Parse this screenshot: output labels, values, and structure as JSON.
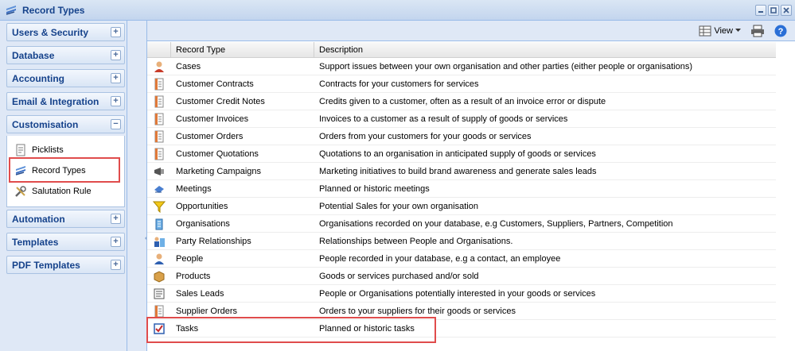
{
  "window": {
    "title": "Record Types"
  },
  "sidebar": {
    "sections": [
      {
        "label": "Users & Security",
        "toggle": "+"
      },
      {
        "label": "Database",
        "toggle": "+"
      },
      {
        "label": "Accounting",
        "toggle": "+"
      },
      {
        "label": "Email & Integration",
        "toggle": "+"
      },
      {
        "label": "Customisation",
        "toggle": "−"
      },
      {
        "label": "Automation",
        "toggle": "+"
      },
      {
        "label": "Templates",
        "toggle": "+"
      },
      {
        "label": "PDF Templates",
        "toggle": "+"
      }
    ],
    "customisation_items": [
      {
        "label": "Picklists",
        "icon": "picklist-icon"
      },
      {
        "label": "Record Types",
        "icon": "record-types-icon",
        "selected": true
      },
      {
        "label": "Salutation Rule",
        "icon": "tools-icon"
      }
    ]
  },
  "toolbar": {
    "view_label": "View"
  },
  "grid": {
    "headers": [
      "Record Type",
      "Description"
    ],
    "rows": [
      {
        "type": "Cases",
        "desc": "Support issues between your own organisation and other parties (either people or organisations)",
        "icon": "case-icon"
      },
      {
        "type": "Customer Contracts",
        "desc": "Contracts for your customers for services",
        "icon": "document-icon"
      },
      {
        "type": "Customer Credit Notes",
        "desc": "Credits given to a customer, often as a result of an invoice error or dispute",
        "icon": "document-icon"
      },
      {
        "type": "Customer Invoices",
        "desc": "Invoices to a customer as a result of supply of goods or services",
        "icon": "document-icon"
      },
      {
        "type": "Customer Orders",
        "desc": "Orders from your customers for your goods or services",
        "icon": "document-icon"
      },
      {
        "type": "Customer Quotations",
        "desc": "Quotations to an organisation in anticipated supply of goods or services",
        "icon": "document-icon"
      },
      {
        "type": "Marketing Campaigns",
        "desc": "Marketing initiatives to build brand awareness and generate sales leads",
        "icon": "campaign-icon"
      },
      {
        "type": "Meetings",
        "desc": "Planned or historic meetings",
        "icon": "meeting-icon"
      },
      {
        "type": "Opportunities",
        "desc": "Potential Sales for your own organisation",
        "icon": "funnel-icon"
      },
      {
        "type": "Organisations",
        "desc": "Organisations recorded on your database, e.g Customers, Suppliers, Partners, Competition",
        "icon": "building-icon"
      },
      {
        "type": "Party Relationships",
        "desc": "Relationships between People and Organisations.",
        "icon": "relationship-icon"
      },
      {
        "type": "People",
        "desc": "People recorded in your database, e.g a contact, an employee",
        "icon": "person-icon"
      },
      {
        "type": "Products",
        "desc": "Goods or services purchased and/or sold",
        "icon": "box-icon"
      },
      {
        "type": "Sales Leads",
        "desc": "People or Organisations potentially interested in your goods or services",
        "icon": "leads-icon"
      },
      {
        "type": "Supplier Orders",
        "desc": "Orders to your suppliers for their goods or services",
        "icon": "document-icon"
      },
      {
        "type": "Tasks",
        "desc": "Planned or historic tasks",
        "icon": "task-icon"
      }
    ]
  },
  "colors": {
    "accent": "#15428b",
    "highlight": "#e04c4c",
    "panel": "#dfe8f6"
  }
}
